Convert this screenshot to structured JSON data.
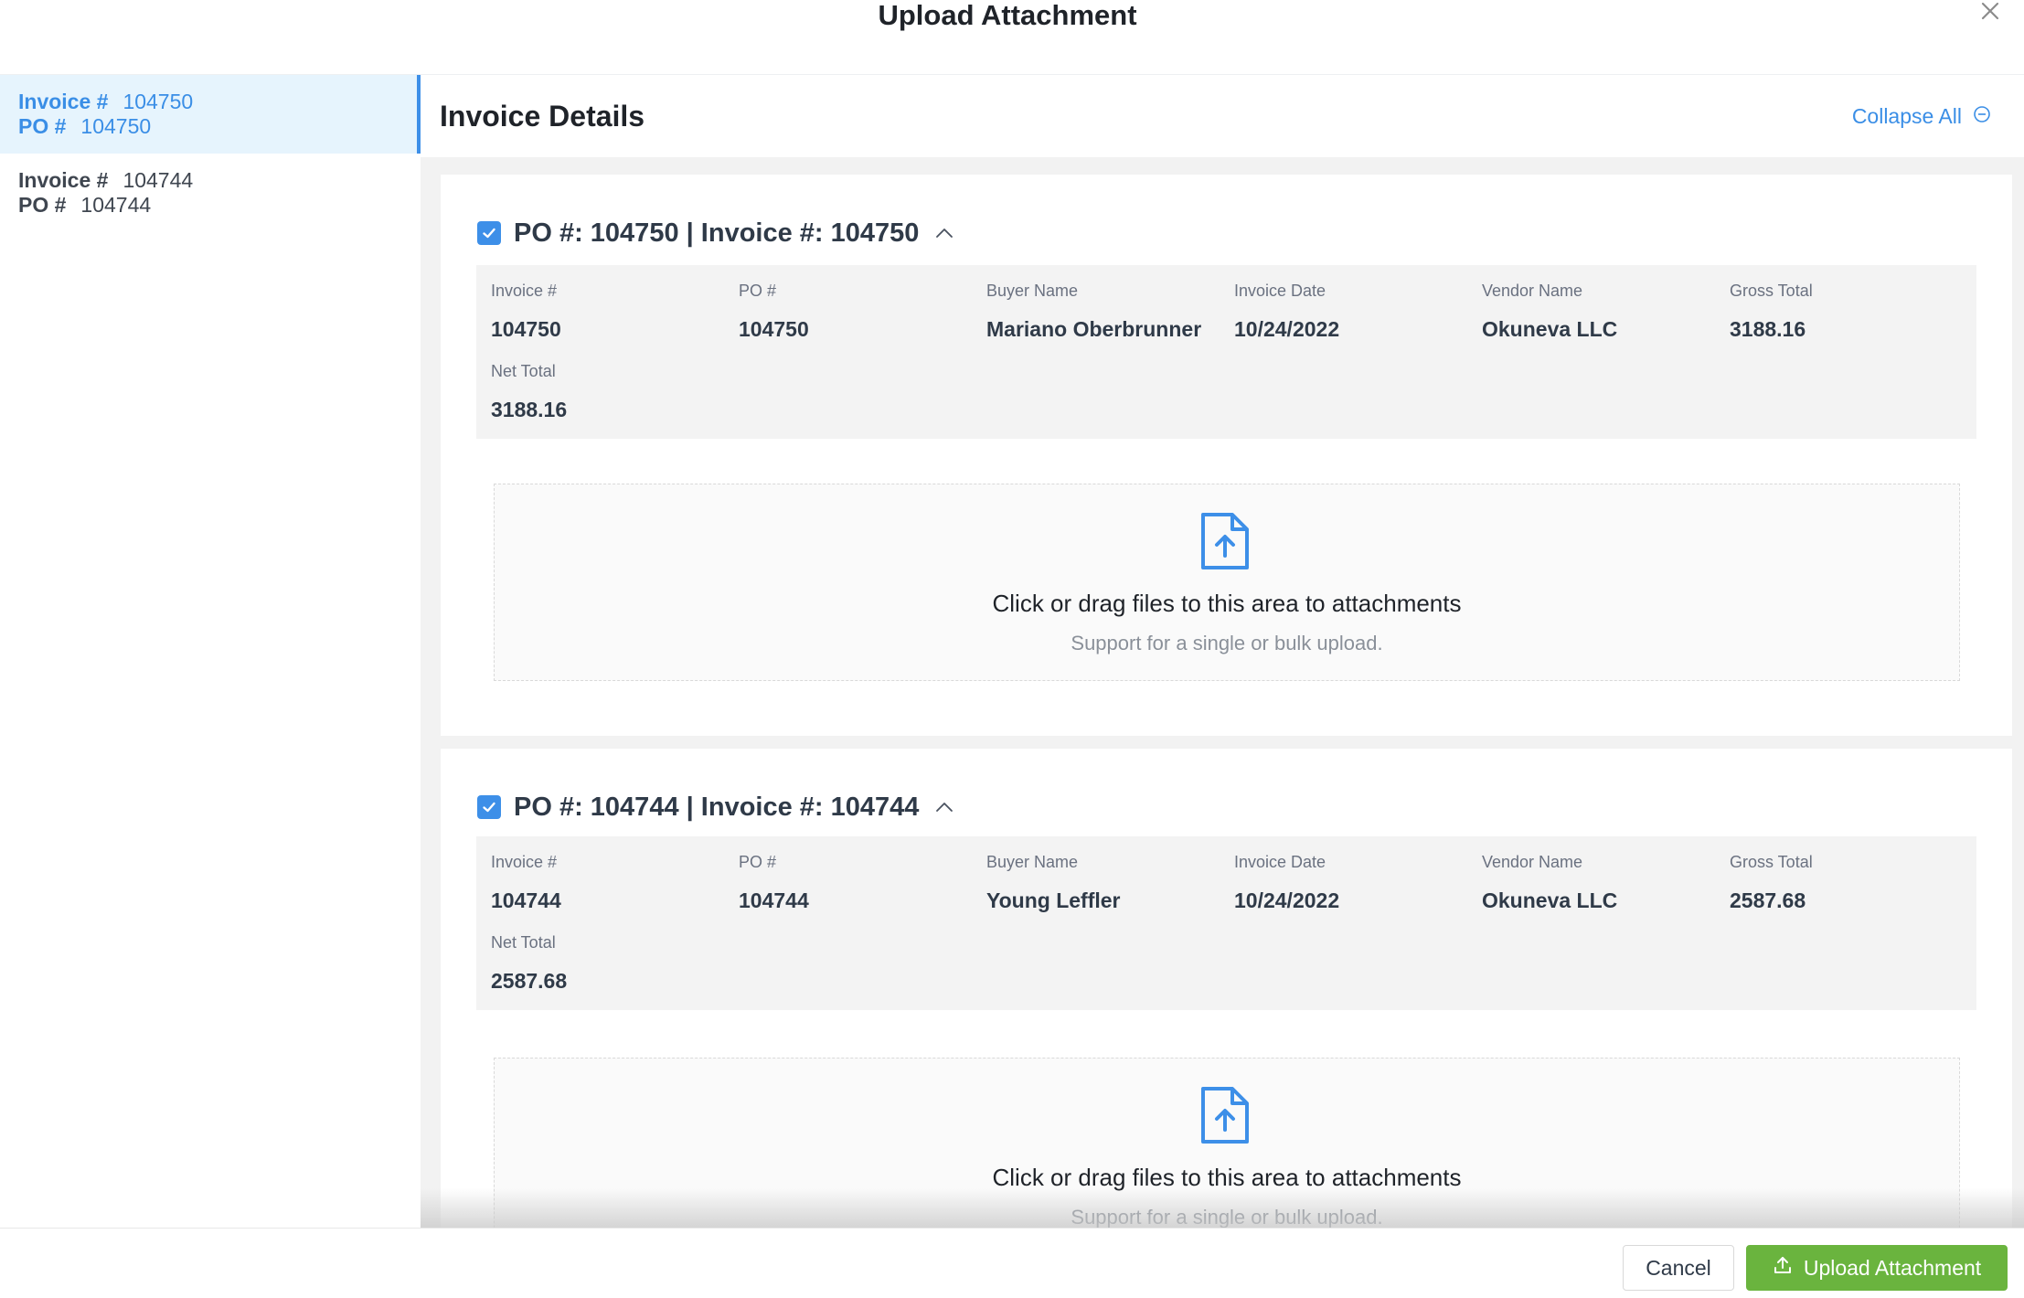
{
  "modal": {
    "title": "Upload Attachment",
    "close_icon": "close-icon"
  },
  "sidebar": {
    "items": [
      {
        "invoice_key": "Invoice #",
        "invoice_val": "104750",
        "po_key": "PO #",
        "po_val": "104750",
        "active": true
      },
      {
        "invoice_key": "Invoice #",
        "invoice_val": "104744",
        "po_key": "PO #",
        "po_val": "104744",
        "active": false
      }
    ]
  },
  "main": {
    "title": "Invoice Details",
    "collapse_all_label": "Collapse All",
    "collapse_icon": "minus-circle-icon",
    "cards": [
      {
        "title": "PO #: 104750 | Invoice #: 104750",
        "checked": true,
        "fields": [
          {
            "label": "Invoice #",
            "value": "104750"
          },
          {
            "label": "PO #",
            "value": "104750"
          },
          {
            "label": "Buyer Name",
            "value": "Mariano Oberbrunner"
          },
          {
            "label": "Invoice Date",
            "value": "10/24/2022"
          },
          {
            "label": "Vendor Name",
            "value": "Okuneva LLC"
          },
          {
            "label": "Gross Total",
            "value": "3188.16"
          },
          {
            "label": "Net Total",
            "value": "3188.16"
          }
        ],
        "dropzone": {
          "text": "Click or drag files to this area to attachments",
          "hint": "Support for a single or bulk upload."
        }
      },
      {
        "title": "PO #: 104744 | Invoice #: 104744",
        "checked": true,
        "fields": [
          {
            "label": "Invoice #",
            "value": "104744"
          },
          {
            "label": "PO #",
            "value": "104744"
          },
          {
            "label": "Buyer Name",
            "value": "Young Leffler"
          },
          {
            "label": "Invoice Date",
            "value": "10/24/2022"
          },
          {
            "label": "Vendor Name",
            "value": "Okuneva LLC"
          },
          {
            "label": "Gross Total",
            "value": "2587.68"
          },
          {
            "label": "Net Total",
            "value": "2587.68"
          }
        ],
        "dropzone": {
          "text": "Click or drag files to this area to attachments",
          "hint": "Support for a single or bulk upload."
        }
      }
    ]
  },
  "footer": {
    "cancel_label": "Cancel",
    "upload_label": "Upload Attachment"
  },
  "colors": {
    "accent": "#3a8ee6",
    "upload_button": "#6ab43e",
    "active_sidebar_bg": "#e6f4fd"
  }
}
